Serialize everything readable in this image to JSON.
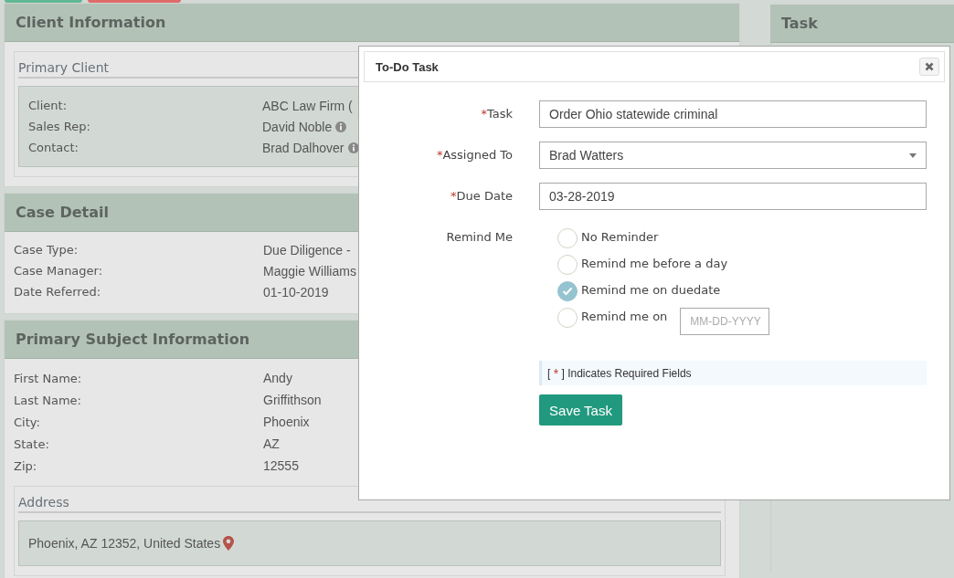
{
  "client_information": {
    "title": "Client Information",
    "primary_client": {
      "legend": "Primary Client",
      "rows": [
        {
          "label": "Client:",
          "value": "ABC Law Firm (",
          "info": false
        },
        {
          "label": "Sales Rep:",
          "value": "David Noble",
          "info": true
        },
        {
          "label": "Contact:",
          "value": "Brad Dalhover",
          "info": true
        }
      ]
    }
  },
  "case_detail": {
    "title": "Case Detail",
    "rows": [
      {
        "label": "Case Type:",
        "value": "Due Diligence -"
      },
      {
        "label": "Case Manager:",
        "value": "Maggie Williams"
      },
      {
        "label": "Date Referred:",
        "value": "01-10-2019"
      }
    ]
  },
  "primary_subject": {
    "title": "Primary Subject Information",
    "rows": [
      {
        "label": "First Name:",
        "value": "Andy"
      },
      {
        "label": "Last Name:",
        "value": "Griffithson"
      },
      {
        "label": "City:",
        "value": "Phoenix"
      },
      {
        "label": "State:",
        "value": "AZ"
      },
      {
        "label": "Zip:",
        "value": "12555"
      }
    ],
    "address": {
      "legend": "Address",
      "text": "Phoenix, AZ 12352, United States"
    }
  },
  "task_panel": {
    "title": "Task"
  },
  "dialog": {
    "title": "To-Do Task",
    "fields": [
      {
        "mark": "*",
        "label": "Task",
        "kind": "text",
        "value": "Order Ohio statewide criminal"
      },
      {
        "mark": "*",
        "label": "Assigned To",
        "kind": "select",
        "value": "Brad Watters"
      },
      {
        "mark": "*",
        "label": "Due Date",
        "kind": "text",
        "value": "03-28-2019"
      }
    ],
    "remind": {
      "label": "Remind Me",
      "options": [
        {
          "label": "No Reminder",
          "selected": false,
          "kind": "plain"
        },
        {
          "label": "Remind me before a day",
          "selected": false,
          "kind": "plain"
        },
        {
          "label": "Remind me on duedate",
          "selected": true,
          "kind": "plain"
        },
        {
          "label": "Remind me on",
          "selected": false,
          "kind": "date",
          "placeholder": "MM-DD-YYYY"
        }
      ]
    },
    "note": {
      "open": "[",
      "mark": "*",
      "text": "] Indicates Required Fields"
    },
    "save_button": "Save Task"
  }
}
